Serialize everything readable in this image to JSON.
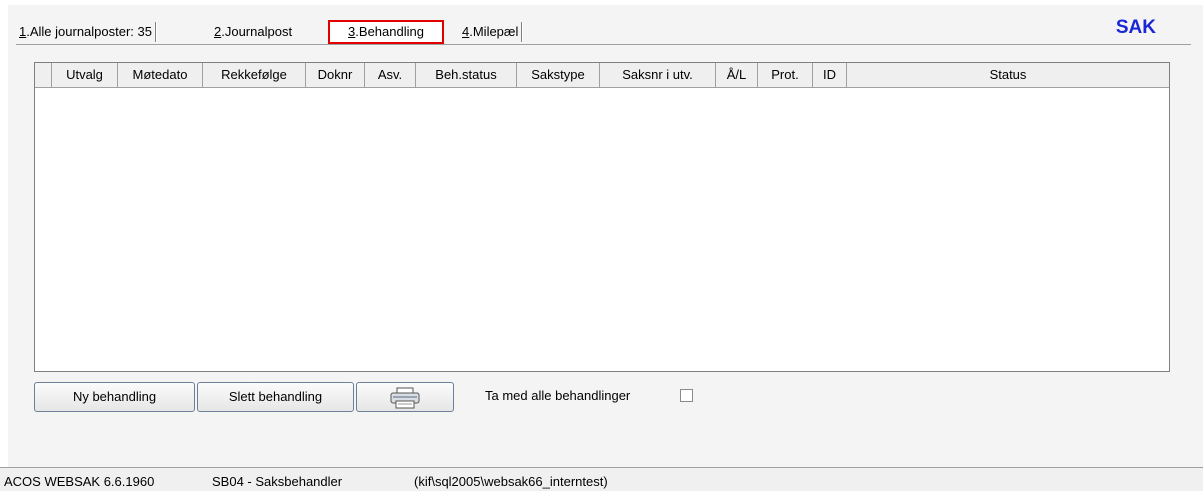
{
  "tabs": [
    {
      "num": "1",
      "label": ".Alle journalposter:  35"
    },
    {
      "num": "2",
      "label": ".Journalpost"
    },
    {
      "num": "3",
      "label": ".Behandling"
    },
    {
      "num": "4",
      "label": ".Milepæl"
    }
  ],
  "header": {
    "title": "SAK"
  },
  "grid": {
    "columns": [
      "Utvalg",
      "Møtedato",
      "Rekkefølge",
      "Doknr",
      "Asv.",
      "Beh.status",
      "Sakstype",
      "Saksnr i utv.",
      "Å/L",
      "Prot.",
      "ID",
      "Status"
    ],
    "rows": []
  },
  "buttons": {
    "new": "Ny behandling",
    "delete": "Slett behandling",
    "print_icon": "printer-icon"
  },
  "option": {
    "label": "Ta med alle behandlinger",
    "checked": false
  },
  "status_bar": {
    "app": "ACOS WEBSAK 6.6.1960",
    "role": "SB04 - Saksbehandler",
    "db": "(kif\\sql2005\\websak66_interntest)"
  },
  "colors": {
    "accent": "#1a25d6",
    "highlight": "#e00000"
  }
}
